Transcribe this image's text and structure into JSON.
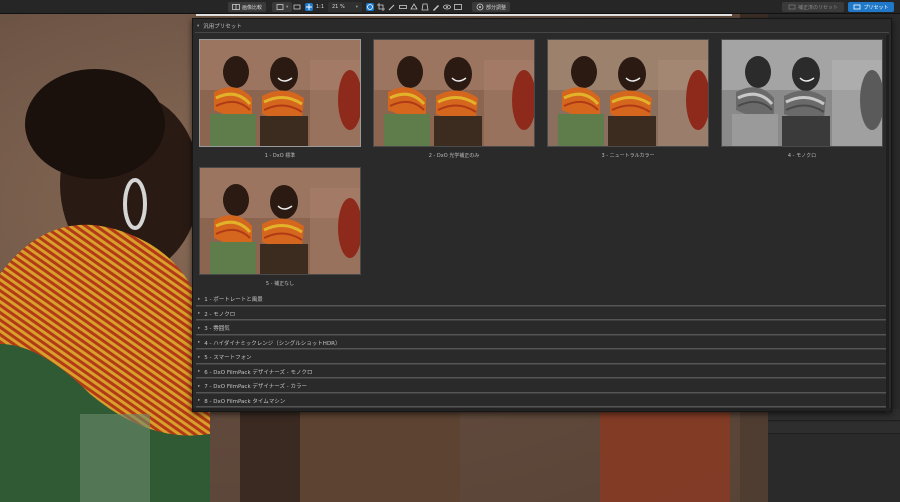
{
  "toolbar": {
    "compare_label": "画像比較",
    "zoom_fit_label": "1:1",
    "zoom_value": "21 %",
    "local_adjust_label": "部分調整",
    "reset_label": "補正済のリセット",
    "preset_label": "プリセット"
  },
  "panel": {
    "title": "汎用プリセット",
    "presets": [
      {
        "label": "1 - DxO 標準",
        "style": "color"
      },
      {
        "label": "2 - DxO 光学補正のみ",
        "style": "color"
      },
      {
        "label": "3 - ニュートラルカラー",
        "style": "neutral"
      },
      {
        "label": "4 - モノクロ",
        "style": "mono"
      },
      {
        "label": "5 - 補正なし",
        "style": "color"
      }
    ],
    "categories": [
      "1 - ポートレートと風景",
      "2 - モノクロ",
      "3 - 雰囲気",
      "4 - ハイダイナミックレンジ（シングルショットHDR）",
      "5 - スマートフォン",
      "6 - DxO FilmPack デザイナーズ - モノクロ",
      "7 - DxO FilmPack デザイナーズ - カラー",
      "8 - DxO FilmPack タイムマシン"
    ]
  },
  "colors": {
    "accent": "#1f78c8",
    "panel_bg": "#2a2a2a"
  },
  "icons": [
    "compare-icon",
    "crop-icon",
    "fit-icon",
    "zoom-icon",
    "hand-icon",
    "crop-tool-icon",
    "eyedropper-icon",
    "redeye-icon",
    "horizon-icon",
    "perspective-icon",
    "brush-icon",
    "eye-icon",
    "local-adjust-icon",
    "preset-icon",
    "reset-icon"
  ]
}
